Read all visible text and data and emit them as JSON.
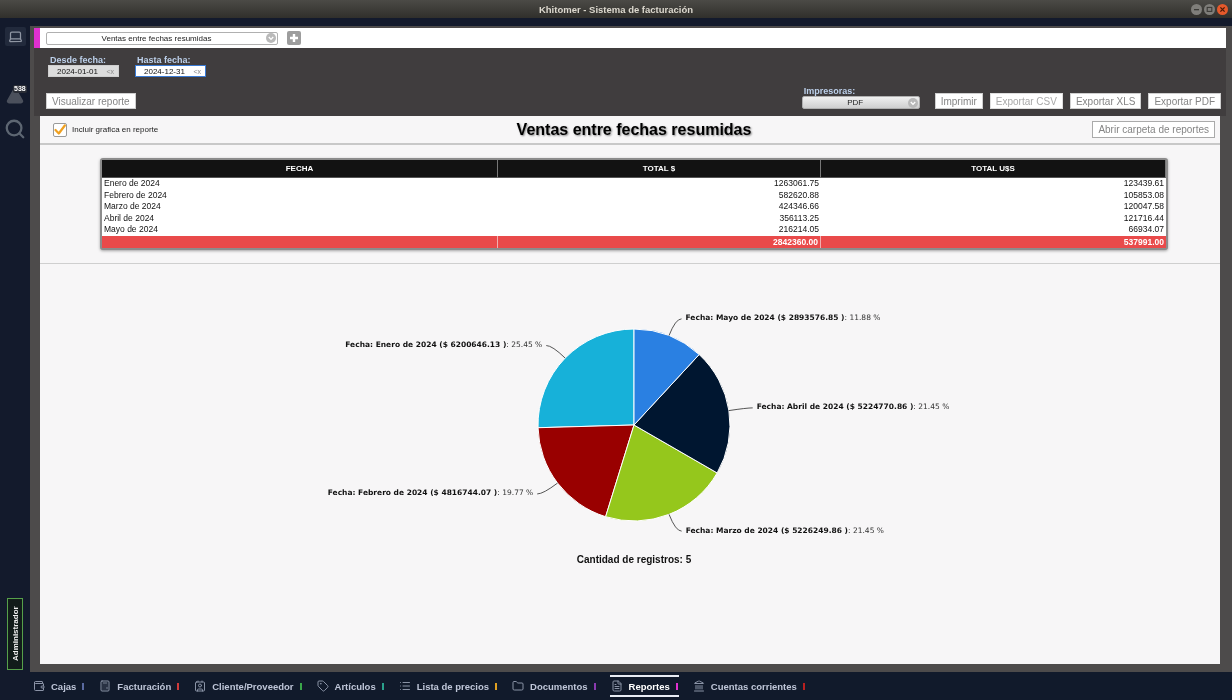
{
  "window": {
    "title": "Khitomer - Sistema de facturación"
  },
  "sidebar": {
    "alert_count": "538",
    "user": "Administrador"
  },
  "report_selector": {
    "value": "Ventas entre fechas resumidas"
  },
  "filters": {
    "date_fields": [
      {
        "label": "Desde fecha:",
        "value": "2024-01-01",
        "clear": "<x",
        "focused": false
      },
      {
        "label": "Hasta fecha:",
        "value": "2024-12-31",
        "clear": "<x",
        "focused": true
      }
    ],
    "view_button": "Visualizar reporte",
    "printer": {
      "label": "Impresoras:",
      "value": "PDF"
    },
    "actions": [
      {
        "label": "Imprimir",
        "disabled": false
      },
      {
        "label": "Exportar CSV",
        "disabled": true
      },
      {
        "label": "Exportar XLS",
        "disabled": false
      },
      {
        "label": "Exportar PDF",
        "disabled": false
      }
    ]
  },
  "report": {
    "include_chart": {
      "label": "Incluir grafica en reporte",
      "checked": true
    },
    "title": "Ventas entre fechas resumidas",
    "open_folder_button": "Abrir carpeta de reportes",
    "table": {
      "columns": [
        "FECHA",
        "TOTAL $",
        "TOTAL U$S"
      ],
      "rows": [
        [
          "Enero de 2024",
          "1263061.75",
          "123439.61"
        ],
        [
          "Febrero de 2024",
          "582620.88",
          "105853.08"
        ],
        [
          "Marzo de 2024",
          "424346.66",
          "120047.58"
        ],
        [
          "Abril de 2024",
          "356113.25",
          "121716.44"
        ],
        [
          "Mayo de 2024",
          "216214.05",
          "66934.07"
        ]
      ],
      "totals": [
        "2842360.00",
        "537991.00"
      ]
    },
    "chart": {
      "chart_data": {
        "type": "pie",
        "values": [
          6200646.13,
          4816744.07,
          5226249.86,
          5224770.86,
          2893576.85
        ],
        "colors": [
          "#17b1d9",
          "#990000",
          "#95c71c",
          "#001630",
          "#2a80e2"
        ],
        "value_labels": [
          "**Fecha: Enero de 2024 ($ 6200646.13 )**: 25.45 %",
          "**Fecha: Febrero de 2024 ($ 4816744.07 )**: 19.77 %",
          "**Fecha: Marzo de 2024 ($ 5226249.86 )**: 21.45 %",
          "**Fecha: Abril de 2024 ($ 5224770.86 )**: 21.45 %",
          "**Fecha: Mayo de 2024 ($ 2893576.85 )**: 11.88 %"
        ]
      }
    },
    "record_count": "Cantidad de registros: 5"
  },
  "taskbar": {
    "tabs": [
      {
        "label": "Cajas",
        "color": "#5a6aa0",
        "selected": false
      },
      {
        "label": "Facturación",
        "color": "#d03a3a",
        "selected": false
      },
      {
        "label": "Cliente/Proveedor",
        "color": "#3aa64a",
        "selected": false
      },
      {
        "label": "Artículos",
        "color": "#2aa08c",
        "selected": false
      },
      {
        "label": "Lista de precios",
        "color": "#e0a020",
        "selected": false
      },
      {
        "label": "Documentos",
        "color": "#8a3ab0",
        "selected": false
      },
      {
        "label": "Reportes",
        "color": "#e030d0",
        "selected": true
      },
      {
        "label": "Cuentas corrientes",
        "color": "#b82020",
        "selected": false
      }
    ]
  }
}
